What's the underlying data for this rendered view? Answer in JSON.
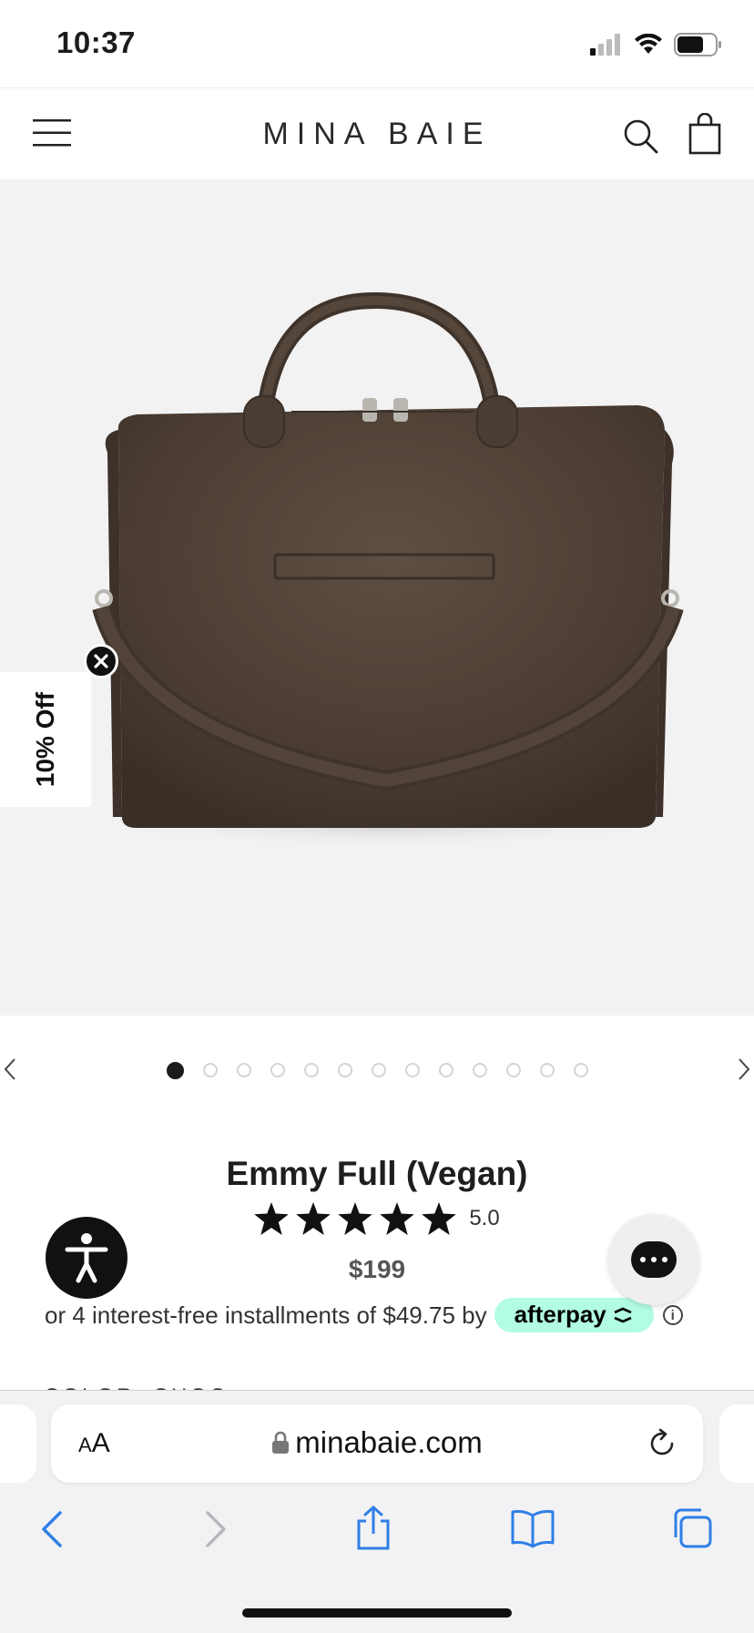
{
  "status": {
    "time": "10:37"
  },
  "header": {
    "brand": "MINA BAIE"
  },
  "promo": {
    "label": "10% Off"
  },
  "carousel": {
    "total": 13,
    "active": 1
  },
  "product": {
    "title": "Emmy Full (Vegan)",
    "rating_value": "5.0",
    "stars": 5,
    "price": "$199",
    "installments_text": "or 4 interest-free installments of $49.75 by",
    "afterpay_label": "afterpay"
  },
  "browser": {
    "aa_label": "AA",
    "url": "minabaie.com"
  },
  "colors": {
    "bag": "#4a3c32",
    "afterpay_mint": "#b2fce4",
    "hero_bg": "#f2f2f3",
    "browser_blue": "#2f7fe6"
  }
}
